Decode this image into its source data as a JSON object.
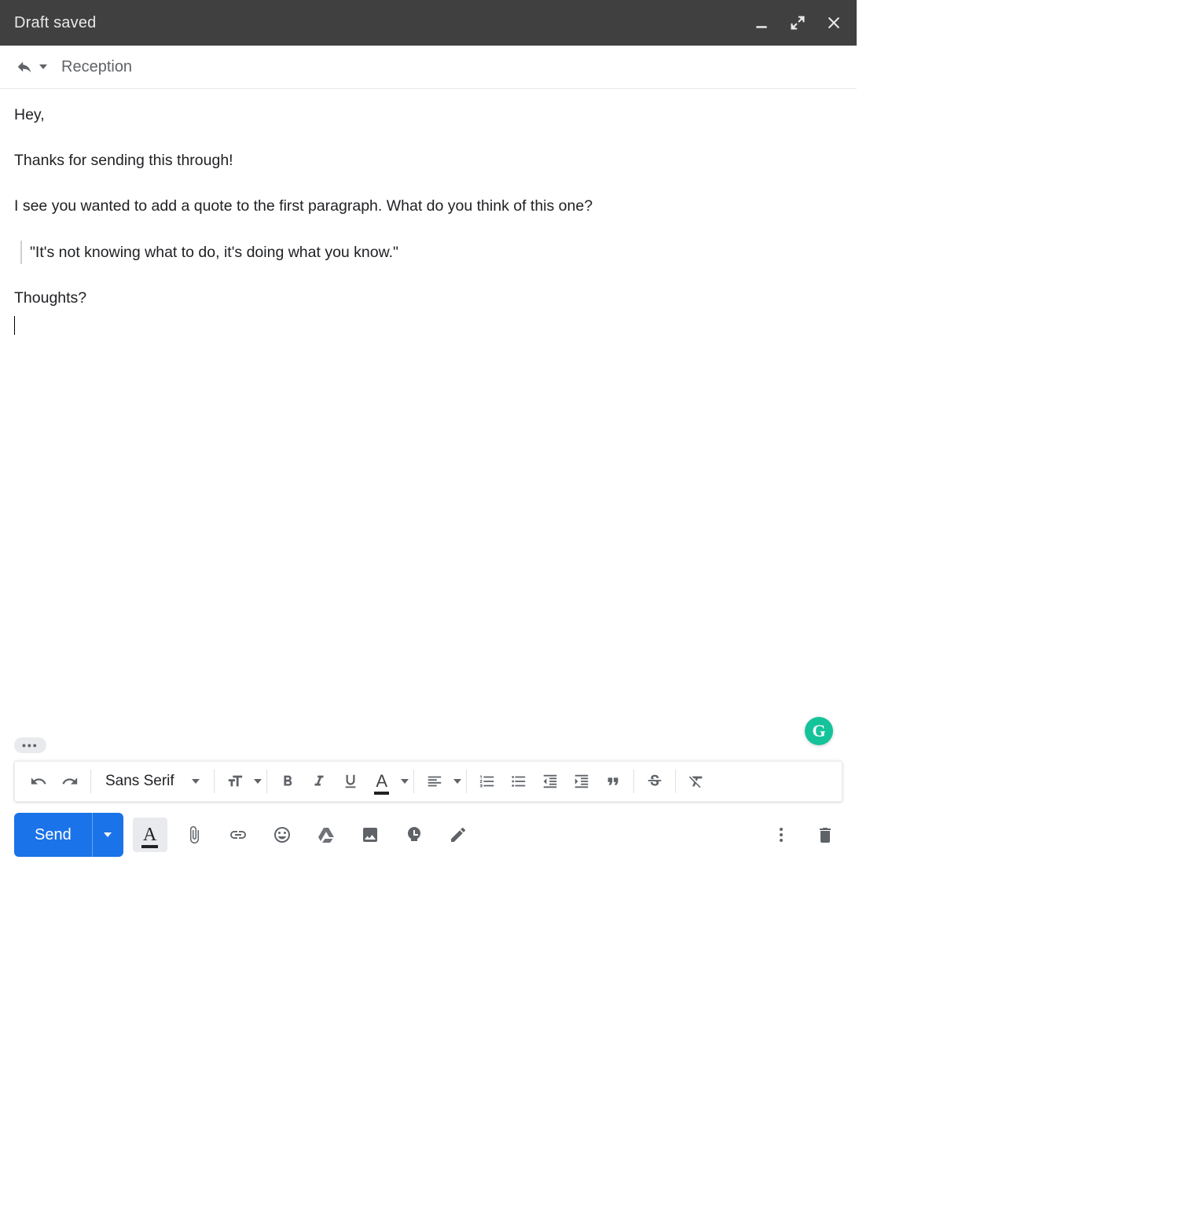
{
  "titlebar": {
    "title": "Draft saved"
  },
  "subject": "Reception",
  "body": {
    "p1": "Hey,",
    "p2": "Thanks for sending this through!",
    "p3": "I see you wanted to add a quote to the first paragraph. What do you think of this one?",
    "quote": "\"It's not knowing what to do, it's doing what you know.\"",
    "p4": "Thoughts?"
  },
  "trim_label": "•••",
  "grammarly_label": "G",
  "font_selector": "Sans Serif",
  "send_label": "Send"
}
